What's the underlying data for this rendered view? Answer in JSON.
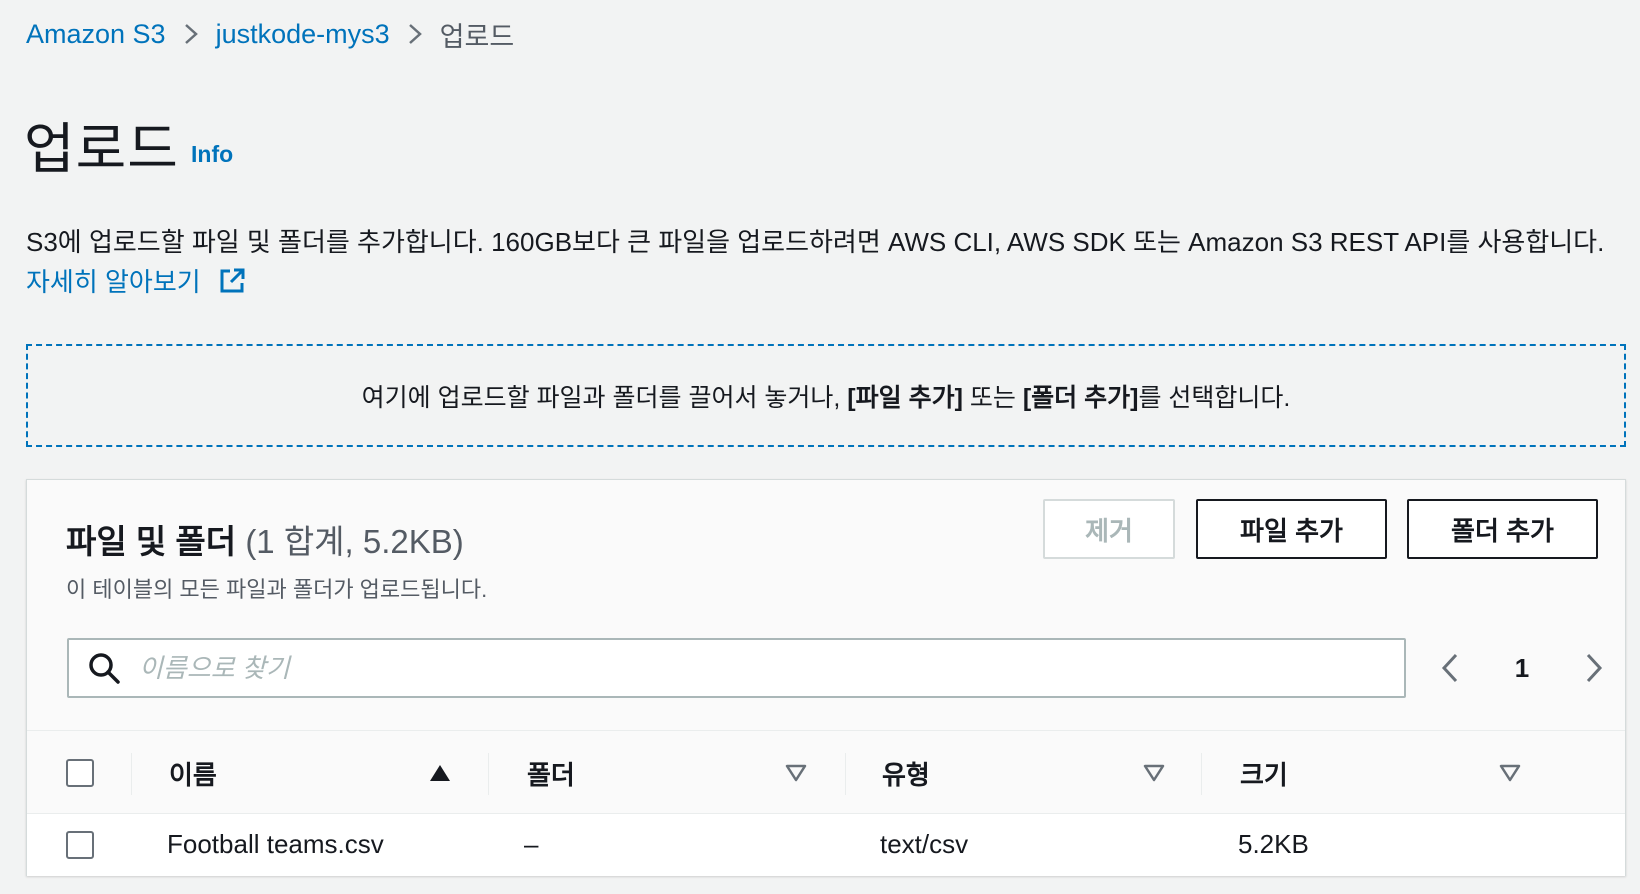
{
  "breadcrumb": {
    "items": [
      "Amazon S3",
      "justkode-mys3"
    ],
    "current": "업로드"
  },
  "page": {
    "title": "업로드",
    "info": "Info",
    "description": "S3에 업로드할 파일 및 폴더를 추가합니다. 160GB보다 큰 파일을 업로드하려면 AWS CLI, AWS SDK 또는 Amazon S3 REST API를 사용합니다.",
    "learn_more": "자세히 알아보기"
  },
  "dropzone": {
    "prefix": "여기에 업로드할 파일과 폴더를 끌어서 놓거나,",
    "add_files": "[파일 추가]",
    "or": "또는",
    "add_folder": "[폴더 추가]",
    "suffix": "를 선택합니다."
  },
  "files_panel": {
    "title": "파일 및 폴더",
    "count": "(1 합계, 5.2KB)",
    "subtitle": "이 테이블의 모든 파일과 폴더가 업로드됩니다.",
    "remove_label": "제거",
    "add_files_label": "파일 추가",
    "add_folder_label": "폴더 추가",
    "search_placeholder": "이름으로 찾기",
    "page": "1",
    "columns": [
      "이름",
      "폴더",
      "유형",
      "크기"
    ],
    "rows": [
      {
        "name": "Football teams.csv",
        "folder": "–",
        "type": "text/csv",
        "size": "5.2KB"
      }
    ]
  },
  "colors": {
    "link": "#0073bb",
    "background": "#f2f3f3",
    "text": "#16191f"
  }
}
